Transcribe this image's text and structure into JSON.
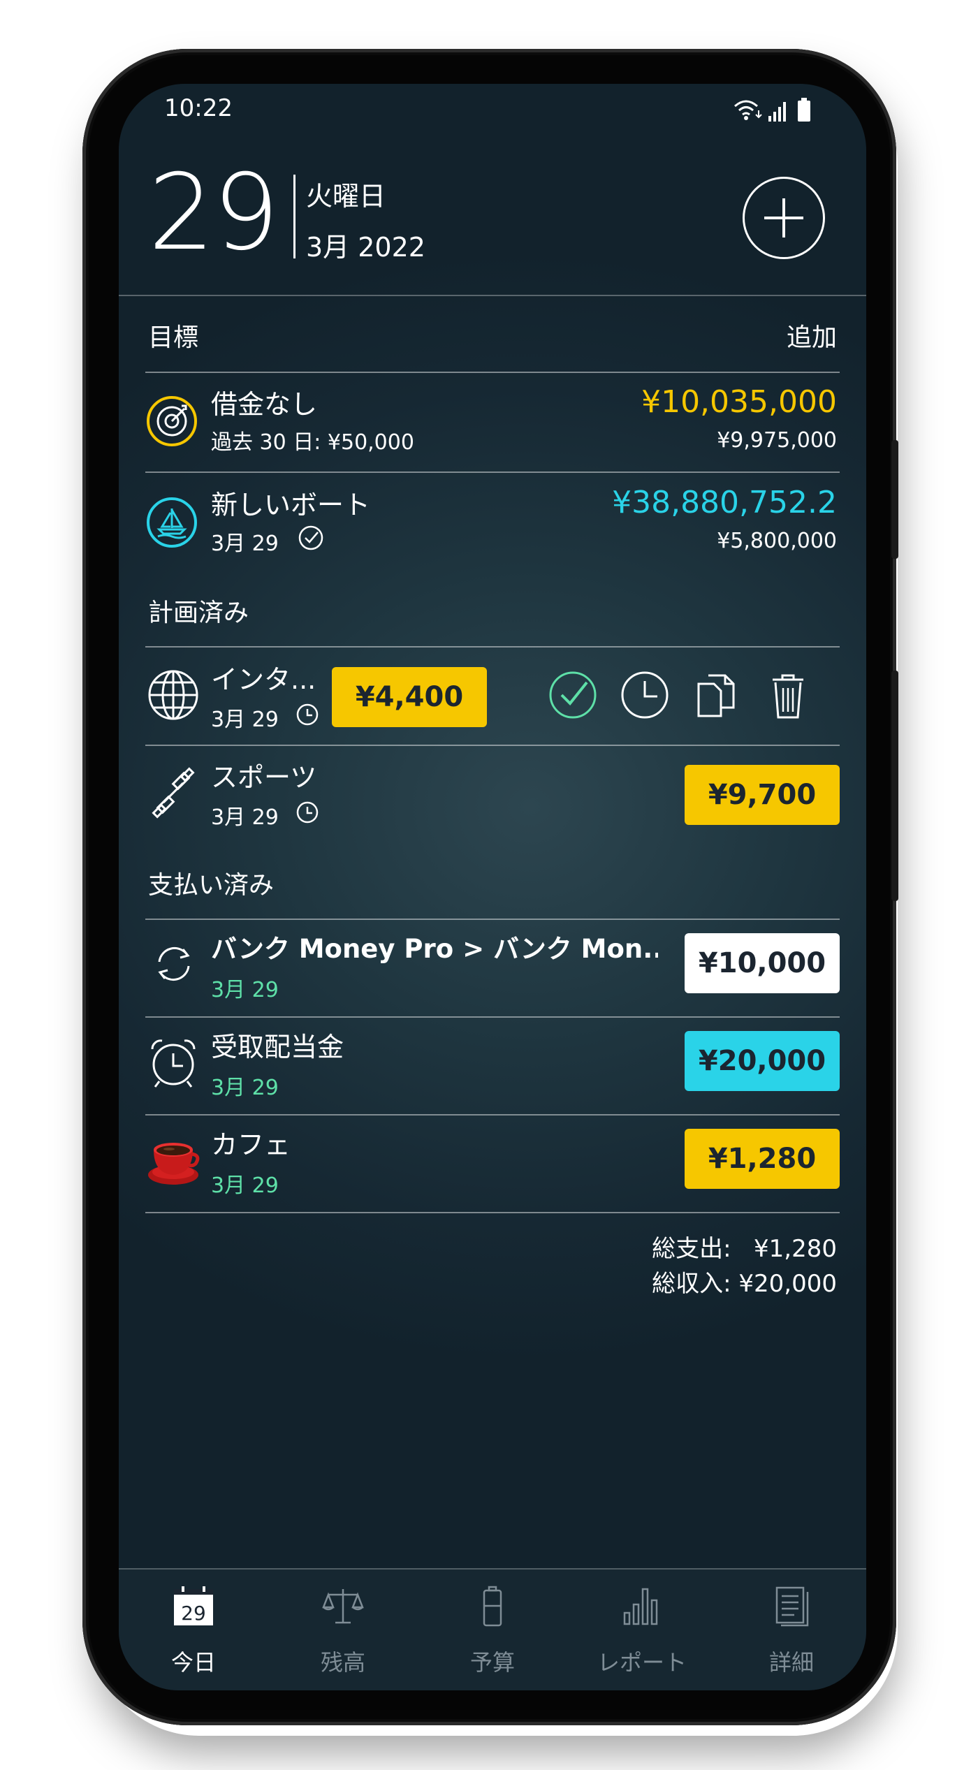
{
  "statusbar": {
    "time": "10:22"
  },
  "header": {
    "day": "29",
    "weekday": "火曜日",
    "month_year": "3月 2022"
  },
  "goals": {
    "title": "目標",
    "add_label": "追加",
    "items": [
      {
        "name": "借金なし",
        "sub": "過去 30 日: ¥50,000",
        "amount": "¥10,035,000",
        "target": "¥9,975,000",
        "color": "#f6c700",
        "icon": "target-icon"
      },
      {
        "name": "新しいボート",
        "sub": "3月 29",
        "amount": "¥38,880,752.2",
        "target": "¥5,800,000",
        "color": "#2ad3e8",
        "icon": "sailboat-icon"
      }
    ]
  },
  "planned": {
    "title": "計画済み",
    "items": [
      {
        "name": "インタ...",
        "date": "3月 29",
        "amount": "¥4,400",
        "icon": "globe-icon"
      },
      {
        "name": "スポーツ",
        "date": "3月 29",
        "amount": "¥9,700",
        "icon": "dumbbell-icon"
      }
    ]
  },
  "paid": {
    "title": "支払い済み",
    "items": [
      {
        "name": "バンク Money Pro > バンク Mon...",
        "date": "3月 29",
        "amount": "¥10,000",
        "icon": "transfer-icon",
        "pill_color": "#ffffff"
      },
      {
        "name": "受取配当金",
        "date": "3月 29",
        "amount": "¥20,000",
        "icon": "alarm-clock-icon",
        "pill_color": "#2ad3e8"
      },
      {
        "name": "カフェ",
        "date": "3月 29",
        "amount": "¥1,280",
        "icon": "coffee-cup-icon",
        "pill_color": "#f6c700"
      }
    ]
  },
  "totals": {
    "expense": "総支出:   ¥1,280",
    "income": "総収入: ¥20,000"
  },
  "tabbar": {
    "items": [
      {
        "label": "今日",
        "icon": "calendar-icon",
        "icon_text": "29",
        "active": true
      },
      {
        "label": "残高",
        "icon": "scales-icon",
        "active": false
      },
      {
        "label": "予算",
        "icon": "battery-icon",
        "active": false
      },
      {
        "label": "レポート",
        "icon": "bar-chart-icon",
        "active": false
      },
      {
        "label": "詳細",
        "icon": "document-icon",
        "active": false
      }
    ]
  },
  "colors": {
    "accent_yellow": "#f6c700",
    "accent_cyan": "#2ad3e8",
    "date_green": "#5ee0a8",
    "background": "#1f3640"
  }
}
